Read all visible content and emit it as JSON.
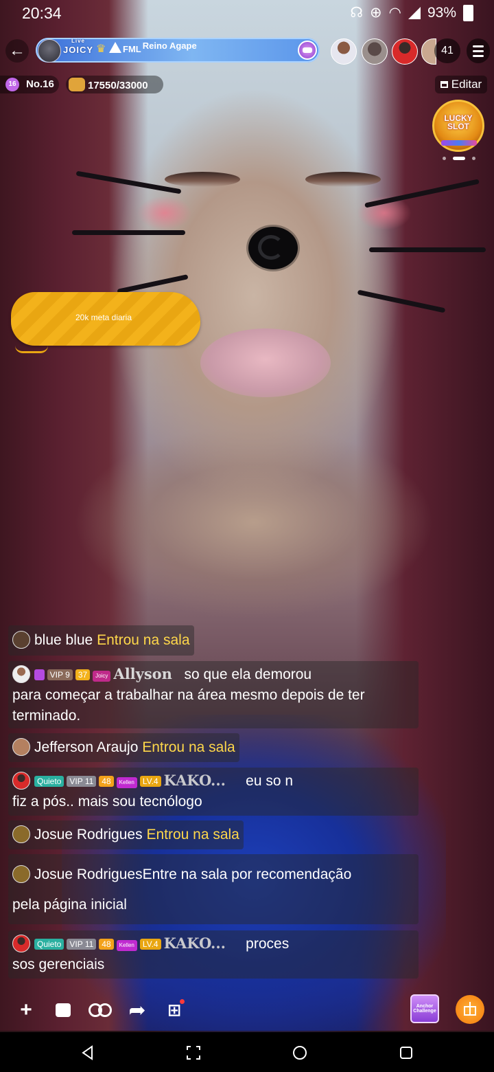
{
  "status_bar": {
    "time": "20:34",
    "battery": "93%",
    "icons": [
      "headset-icon",
      "data-saver-icon",
      "wifi-icon",
      "signal-icon",
      "battery-icon"
    ]
  },
  "header": {
    "host_logo_small": "Live",
    "host_logo": "JOICY",
    "host_tag": "FML",
    "host_name": "Reino Agape",
    "viewer_count": "41"
  },
  "stats": {
    "rank": "No.16",
    "rank_level": "16",
    "goal_progress": "17550/33000",
    "edit_label": "Editar"
  },
  "lucky_slot": {
    "label": "LUCKY SLOT"
  },
  "goal_sticker": {
    "text": "20k meta diaria"
  },
  "chat": [
    {
      "type": "enter",
      "user": "blue blue",
      "action": "Entrou na sala"
    },
    {
      "type": "message",
      "tags": [
        "VIP 9",
        "37",
        "Joicy"
      ],
      "user": "Allyson",
      "text": "so que ela demorou",
      "text2": "para começar a trabalhar na área mesmo depois de ter",
      "text3": "terminado."
    },
    {
      "type": "enter",
      "user": "Jefferson Araujo",
      "action": "Entrou na sala"
    },
    {
      "type": "message",
      "tags": [
        "Quieto",
        "VIP 11",
        "48",
        "Kellen",
        "LV.4"
      ],
      "user": "KAKO...",
      "text": "eu so n",
      "text2": "fiz a pós.. mais sou tecnólogo"
    },
    {
      "type": "enter",
      "user": "Josue Rodrigues",
      "action": "Entrou na sala"
    },
    {
      "type": "recommend",
      "user": "Josue Rodrigues",
      "text": "Entre na sala por recomendação",
      "text2": "pela página inicial"
    },
    {
      "type": "message",
      "tags": [
        "Quieto",
        "VIP 11",
        "48",
        "Kellen",
        "LV.4"
      ],
      "user": "KAKO...",
      "text": "proces",
      "text2": "sos gerenciais"
    }
  ],
  "toolbar": {
    "add": "+",
    "anchor_challenge": "Anchor Challenge"
  },
  "colors": {
    "enter_text": "#ffd84a",
    "host_pill": "#5a95ea",
    "goal_sticker": "#f3b21b"
  }
}
